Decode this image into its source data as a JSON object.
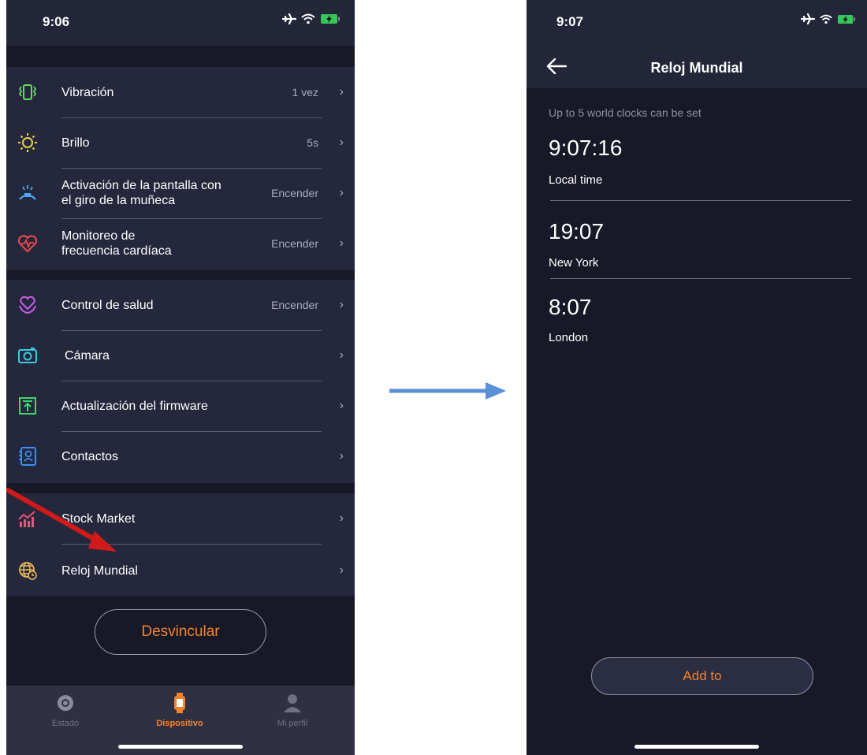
{
  "colors": {
    "background": "#181926",
    "panel": "#25273c",
    "accent": "#f5822a",
    "text_secondary": "#a9abbd"
  },
  "left_screen": {
    "status_time": "9:06",
    "status_icons": [
      "airplane-icon",
      "wifi-icon",
      "battery-charging-icon"
    ],
    "groups": [
      {
        "items": [
          {
            "icon": "vibration-icon",
            "label": "Vibración",
            "value": "1 vez"
          },
          {
            "icon": "brightness-icon",
            "label": "Brillo",
            "value": "5s"
          },
          {
            "icon": "wrist-turn-icon",
            "label_line1": "Activación de la pantalla con",
            "label_line2": "el giro de la muñeca",
            "value": "Encender"
          },
          {
            "icon": "heart-rate-icon",
            "label_line1": "Monitoreo de",
            "label_line2": "frecuencia cardíaca",
            "value": "Encender"
          }
        ]
      },
      {
        "items": [
          {
            "icon": "health-heart-icon",
            "label": "Control de salud",
            "value": "Encender"
          },
          {
            "icon": "camera-icon",
            "label": "Cámara",
            "value": ""
          },
          {
            "icon": "firmware-update-icon",
            "label": "Actualización del firmware",
            "value": ""
          },
          {
            "icon": "contacts-icon",
            "label": "Contactos",
            "value": ""
          }
        ]
      },
      {
        "items": [
          {
            "icon": "stock-chart-icon",
            "label": "Stock Market",
            "value": ""
          },
          {
            "icon": "globe-clock-icon",
            "label": "Reloj Mundial",
            "value": ""
          }
        ]
      }
    ],
    "chevron": "›",
    "unlink_button": "Desvincular",
    "tabs": [
      {
        "icon": "status-icon",
        "label": "Estado",
        "active": false
      },
      {
        "icon": "device-icon",
        "label": "Dispositivo",
        "active": true
      },
      {
        "icon": "profile-icon",
        "label": "Mi perfil",
        "active": false
      }
    ]
  },
  "right_screen": {
    "status_time": "9:07",
    "title": "Reloj Mundial",
    "note": "Up to 5 world clocks can be set",
    "clocks": [
      {
        "time": "9:07:16",
        "city": "Local time"
      },
      {
        "time": "19:07",
        "city": "New York"
      },
      {
        "time": "8:07",
        "city": "London"
      }
    ],
    "add_button": "Add to"
  }
}
